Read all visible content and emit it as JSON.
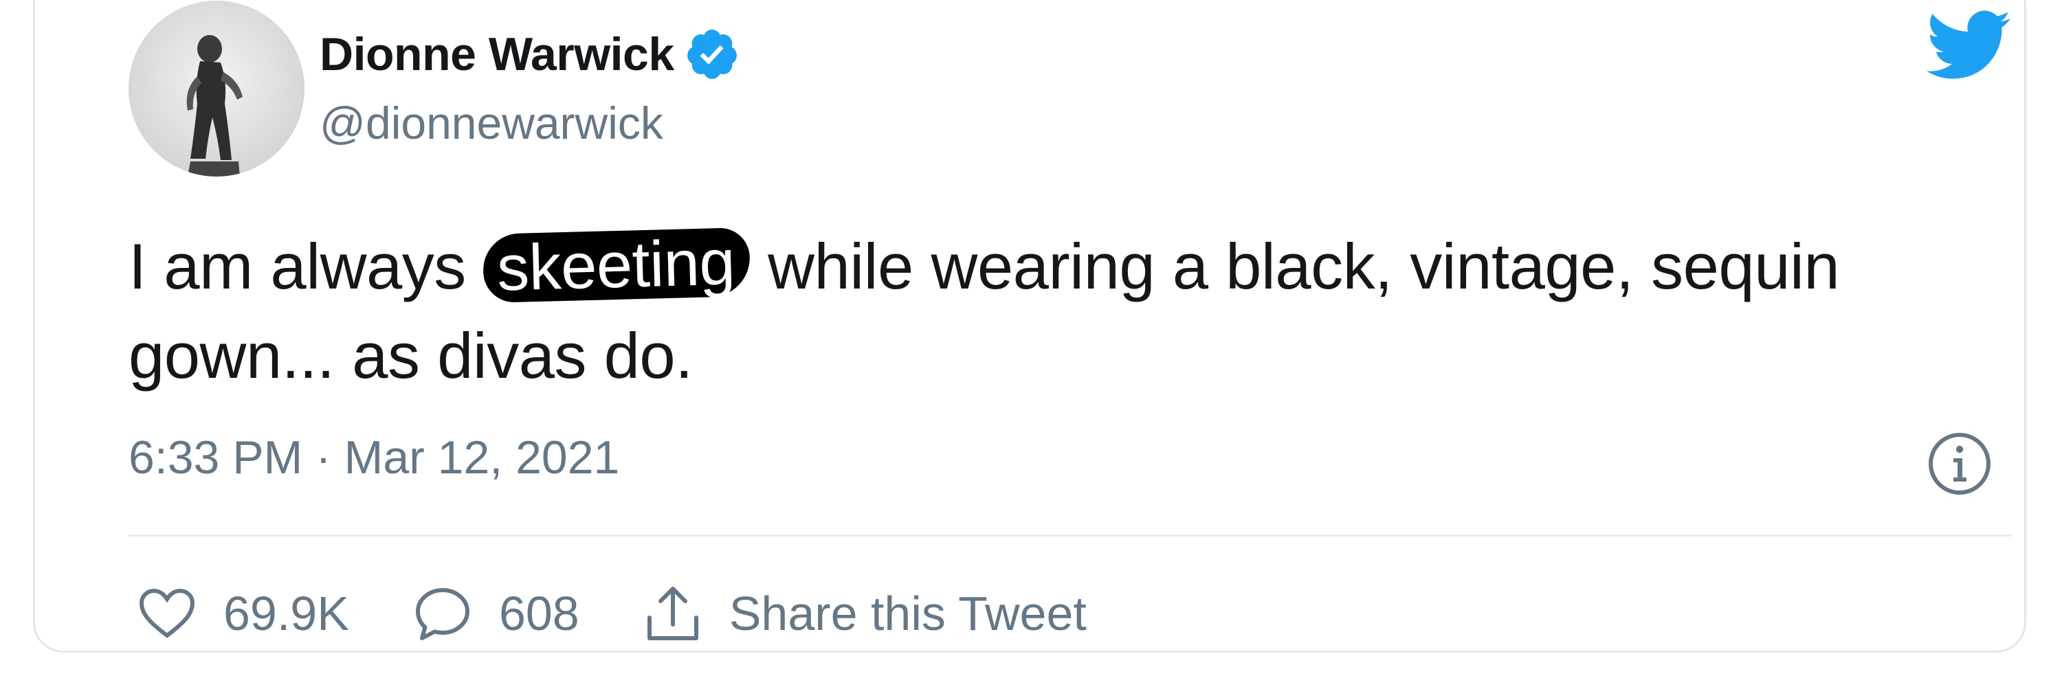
{
  "tweet": {
    "author": {
      "display_name": "Dionne Warwick",
      "handle": "@dionnewarwick",
      "verified": true,
      "avatar_icon": "avatar-photo"
    },
    "text_before": "I am always ",
    "redacted_word": "skeeting",
    "text_after": " while wearing a black, vintage, sequin gown... as divas do.",
    "timestamp": "6:33 PM · Mar 12, 2021",
    "likes": "69.9K",
    "replies": "608",
    "share_label": "Share this Tweet"
  },
  "icons": {
    "brand": "twitter-bird-icon",
    "verified": "verified-badge-icon",
    "info": "info-icon",
    "like": "heart-icon",
    "reply": "reply-bubble-icon",
    "share": "share-icon"
  },
  "colors": {
    "brand_blue": "#1da1f2",
    "text_primary": "#14171a",
    "text_secondary": "#657786",
    "border": "#e3e6e9"
  }
}
